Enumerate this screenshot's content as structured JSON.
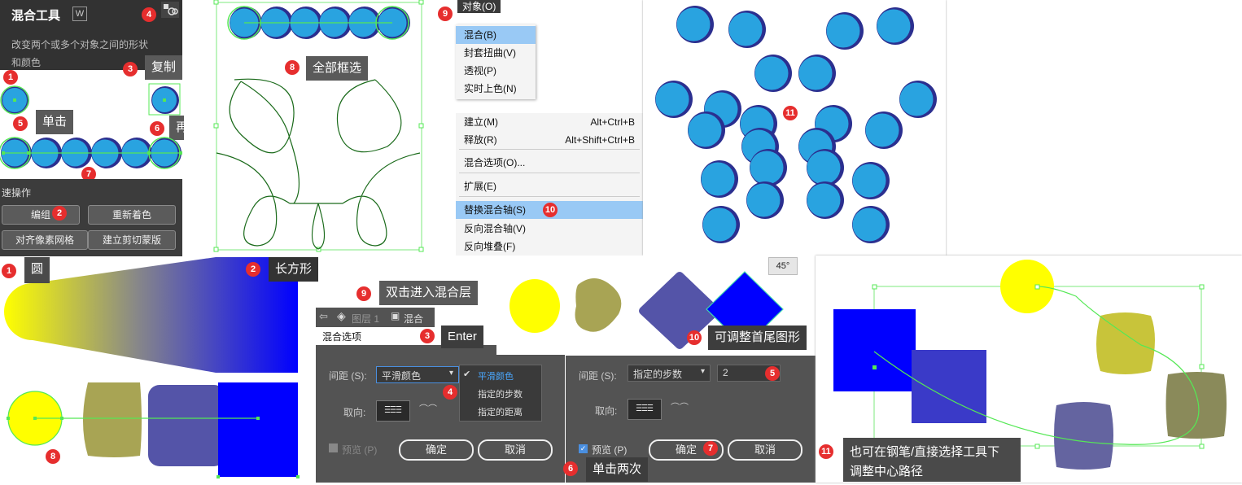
{
  "tool_panel": {
    "title": "混合工具",
    "shortcut": "W",
    "description_line1": "改变两个或多个对象之间的形状",
    "description_line2": "和颜色"
  },
  "quick_actions": {
    "title": "速操作",
    "group": "编组",
    "recolor": "重新着色",
    "align_pixel_grid": "对齐像素网格",
    "make_clipping_mask": "建立剪切蒙版"
  },
  "callouts_top": {
    "copy": "复制",
    "click": "单击",
    "click_again": "再单击",
    "select_all": "全部框选"
  },
  "object_menu": {
    "title": "对象(O)",
    "submenu_items": [
      "混合(B)",
      "封套扭曲(V)",
      "透视(P)",
      "实时上色(N)"
    ],
    "blend_items": [
      {
        "label": "建立(M)",
        "shortcut": "Alt+Ctrl+B"
      },
      {
        "label": "释放(R)",
        "shortcut": "Alt+Shift+Ctrl+B"
      },
      {
        "label": "混合选项(O)...",
        "shortcut": ""
      },
      {
        "label": "扩展(E)",
        "shortcut": ""
      },
      {
        "label": "替换混合轴(S)",
        "shortcut": ""
      },
      {
        "label": "反向混合轴(V)",
        "shortcut": ""
      },
      {
        "label": "反向堆叠(F)",
        "shortcut": ""
      }
    ]
  },
  "bottom_callouts": {
    "circle": "圆",
    "rectangle": "长方形",
    "double_click": "双击进入混合层",
    "enter": "Enter",
    "adjust_shapes": "可调整首尾图形",
    "click_twice": "单击两次",
    "pen_adjust_line1": "也可在钢笔/直接选择工具下",
    "pen_adjust_line2": "调整中心路径"
  },
  "layers_bar": {
    "layer": "图层 1",
    "blend": "混合"
  },
  "angle_readout": "45°",
  "blend_dialog_left": {
    "title": "混合选项",
    "spacing_label": "间距 (S):",
    "spacing_value": "平滑颜色",
    "dropdown_options": [
      "平滑颜色",
      "指定的步数",
      "指定的距离"
    ],
    "orientation_label": "取向:",
    "preview_label": "预览 (P)",
    "ok": "确定",
    "cancel": "取消"
  },
  "blend_dialog_right": {
    "spacing_label": "间距 (S):",
    "spacing_value": "指定的步数",
    "steps_value": "2",
    "orientation_label": "取向:",
    "preview_label": "预览 (P)",
    "ok": "确定",
    "cancel": "取消"
  },
  "badges": {
    "b1": "1",
    "b2": "2",
    "b3": "3",
    "b4": "4",
    "b5": "5",
    "b6": "6",
    "b7": "7",
    "b8": "8",
    "b9": "9",
    "b10": "10",
    "b11": "11"
  },
  "colors": {
    "circle_fill": "#29a3e0",
    "circle_edge": "#2b2f8f",
    "selection": "#55e855",
    "yellow": "#ffff00",
    "blue": "#0000ff",
    "olive": "#a8a454",
    "purple": "#5454a8",
    "badge": "#e62e2e"
  }
}
